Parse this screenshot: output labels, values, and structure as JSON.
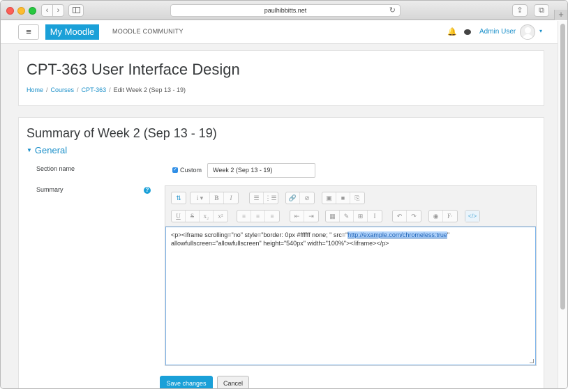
{
  "browser": {
    "url": "paulhibbitts.net",
    "back_icon": "‹",
    "forward_icon": "›",
    "reload_icon": "↻",
    "share_icon": "⇪",
    "tabs_icon": "⧉",
    "plus_icon": "+"
  },
  "navbar": {
    "menu_icon": "≡",
    "brand": "My Moodle",
    "community": "MOODLE COMMUNITY",
    "bell_icon": "🔔",
    "user": "Admin User",
    "caret": "▾",
    "brand_color": "#1aa0d8"
  },
  "header": {
    "course_title": "CPT-363 User Interface Design",
    "breadcrumb": {
      "home": "Home",
      "courses": "Courses",
      "course": "CPT-363",
      "current": "Edit Week 2 (Sep 13 - 19)",
      "separator": "/"
    }
  },
  "form": {
    "title": "Summary of Week 2 (Sep 13 - 19)",
    "section_header": "General",
    "section_name_label": "Section name",
    "custom_checked": "✓",
    "custom_label": "Custom",
    "section_name_value": "Week 2 (Sep 13 - 19)",
    "summary_label": "Summary",
    "help_icon": "?",
    "editor": {
      "row1": [
        {
          "name": "collapse",
          "glyph": "⇅"
        },
        {
          "name": "style",
          "glyph": "i ▾"
        },
        {
          "name": "bold",
          "glyph": "B"
        },
        {
          "name": "italic",
          "glyph": "I"
        },
        {
          "name": "unordered-list",
          "glyph": "☰"
        },
        {
          "name": "ordered-list",
          "glyph": "⋮☰"
        },
        {
          "name": "link",
          "glyph": "🔗"
        },
        {
          "name": "unlink",
          "glyph": "⊘"
        },
        {
          "name": "image",
          "glyph": "▣"
        },
        {
          "name": "media",
          "glyph": "■"
        },
        {
          "name": "manage-files",
          "glyph": "⎘"
        }
      ],
      "row2": [
        {
          "name": "underline",
          "glyph": "U"
        },
        {
          "name": "strikethrough",
          "glyph": "S"
        },
        {
          "name": "subscript",
          "glyph": "x₂"
        },
        {
          "name": "superscript",
          "glyph": "x²"
        },
        {
          "name": "align-left",
          "glyph": "≡"
        },
        {
          "name": "align-center",
          "glyph": "≡"
        },
        {
          "name": "align-right",
          "glyph": "≡"
        },
        {
          "name": "indent",
          "glyph": "⇤"
        },
        {
          "name": "outdent",
          "glyph": "⇥"
        },
        {
          "name": "equation",
          "glyph": "▦"
        },
        {
          "name": "character-map",
          "glyph": "✎"
        },
        {
          "name": "table",
          "glyph": "⊞"
        },
        {
          "name": "clear-formatting",
          "glyph": "I"
        },
        {
          "name": "undo",
          "glyph": "↶"
        },
        {
          "name": "redo",
          "glyph": "↷"
        },
        {
          "name": "accessibility-checker",
          "glyph": "◉"
        },
        {
          "name": "screenreader-helper",
          "glyph": "F·"
        },
        {
          "name": "html",
          "glyph": "</>"
        }
      ],
      "content_before": "<p><iframe scrolling=\"no\" style=\"border: 0px #ffffff none; \" src=\"",
      "content_selected": "http://example.com/chromeless:true",
      "content_after": "\" allowfullscreen=\"allowfullscreen\" height=\"540px\" width=\"100%\"></iframe></p>"
    },
    "save_label": "Save changes",
    "cancel_label": "Cancel"
  }
}
